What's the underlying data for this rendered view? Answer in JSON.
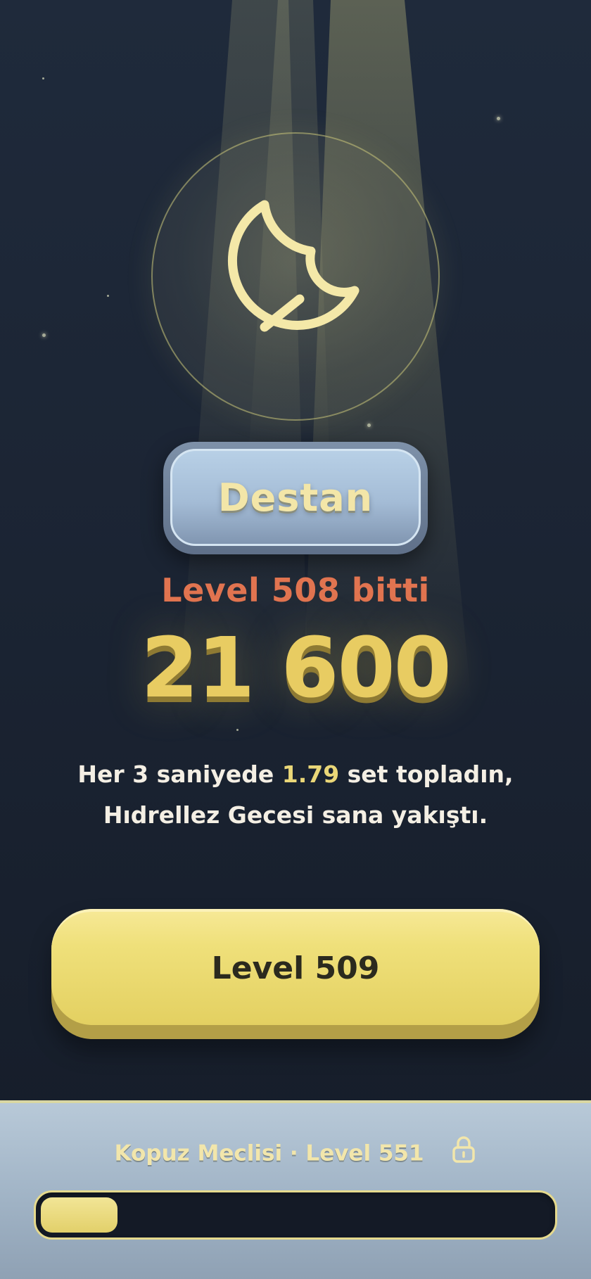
{
  "rank": {
    "label": "Destan"
  },
  "result": {
    "level_done": "Level 508 bitti",
    "score": "21 600"
  },
  "summary": {
    "line1_prefix": "Her 3 saniyede ",
    "line1_value": "1.79",
    "line1_suffix": " set topladın,",
    "line2": "Hıdrellez Gecesi sana yakıştı."
  },
  "next_button": {
    "label": "Level 509"
  },
  "footer": {
    "goal": "Kopuz Meclisi · Level 551",
    "progress": 0.15,
    "icon": "lock-icon"
  },
  "medallion_icon": "crescent-moon-icon",
  "colors": {
    "accent_gold": "#e8cc62",
    "level_done": "#e17450",
    "button_yellow": "#efe07a",
    "background": "#1b2433"
  }
}
